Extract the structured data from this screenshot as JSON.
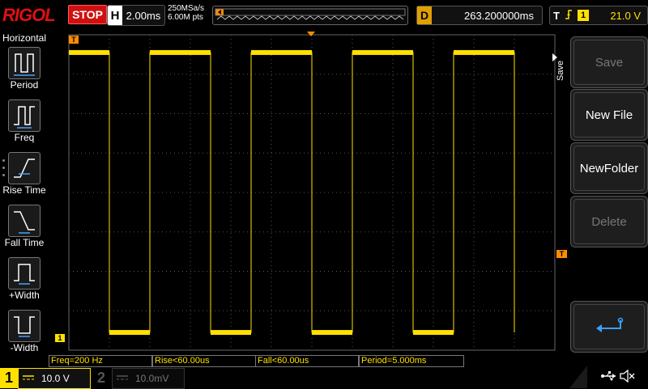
{
  "header": {
    "logo": "RIGOL",
    "run_state": "STOP",
    "horizontal": {
      "letter": "H",
      "value": "2.00ms"
    },
    "sample_rate": "250MSa/s",
    "memory_depth": "6.00M pts",
    "delay": {
      "letter": "D",
      "value": "263.200000ms"
    },
    "trigger": {
      "letter": "T",
      "edge_icon": "rising-edge-icon",
      "source": "1",
      "level": "21.0 V"
    }
  },
  "left_panel": {
    "title": "Horizontal",
    "items": [
      {
        "label": "Period",
        "icon": "period-icon"
      },
      {
        "label": "Freq",
        "icon": "freq-icon"
      },
      {
        "label": "Rise Time",
        "icon": "rise-time-icon"
      },
      {
        "label": "Fall Time",
        "icon": "fall-time-icon"
      },
      {
        "label": "+Width",
        "icon": "pos-width-icon"
      },
      {
        "label": "-Width",
        "icon": "neg-width-icon"
      }
    ]
  },
  "right_menu": {
    "title": "Save",
    "keys": [
      {
        "label": "Save",
        "enabled": false
      },
      {
        "label": "New File",
        "enabled": true
      },
      {
        "label": "NewFolder",
        "enabled": true
      },
      {
        "label": "Delete",
        "enabled": false
      },
      {
        "label": "",
        "icon": "return-arrow-icon",
        "enabled": true
      }
    ]
  },
  "measurements": {
    "freq": "Freq=200 Hz",
    "rise": "Rise<60.00us",
    "fall": "Fall<60.00us",
    "period": "Period=5.000ms"
  },
  "markers": {
    "trigger_pos": "T",
    "ch1_ground": "1",
    "trigger_level": "T"
  },
  "channels": {
    "ch1": {
      "number": "1",
      "coupling_icon": "dc-coupling-icon",
      "scale": "10.0 V"
    },
    "ch2": {
      "number": "2",
      "coupling_icon": "dc-coupling-icon",
      "scale": "10.0mV"
    }
  },
  "status_icons": [
    "usb-icon",
    "mute-icon"
  ],
  "colors": {
    "ch1": "#ffe000",
    "stop": "#d01010",
    "logo": "#e01010",
    "trigger_marker": "#ff8c00"
  },
  "waveform": {
    "type": "square",
    "frequency_hz": 200,
    "period_ms": 5.0,
    "time_per_div_ms": 2.0,
    "high_div": 3.55,
    "low_div": -3.55,
    "duty_cycle": 0.6
  }
}
